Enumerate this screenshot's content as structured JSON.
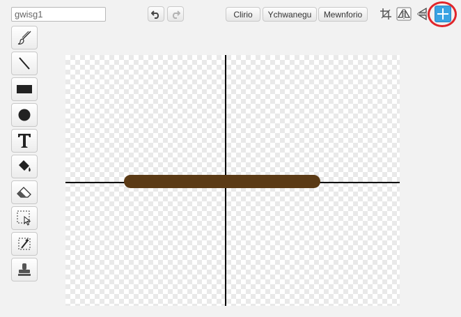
{
  "costume_name": {
    "value": "gwisg1"
  },
  "toolbar": {
    "clear_label": "Clirio",
    "import_label": "Ychwanegu",
    "export_label": "Mewnforio"
  },
  "icons": {
    "undo": "undo-icon",
    "redo": "redo-icon",
    "crop": "crop-icon",
    "flip_horizontal": "flip-horizontal-icon",
    "flip_vertical": "flip-vertical-icon",
    "set_center": "set-center-icon"
  },
  "tools": [
    "paintbrush",
    "line",
    "rectangle",
    "ellipse",
    "text",
    "fill",
    "eraser",
    "select",
    "select-remove-background",
    "stamp"
  ],
  "colors": {
    "accent": "#3aa3e3",
    "highlight": "#e0262b",
    "drawn_line": "#5b3a15",
    "axis": "#000000"
  }
}
